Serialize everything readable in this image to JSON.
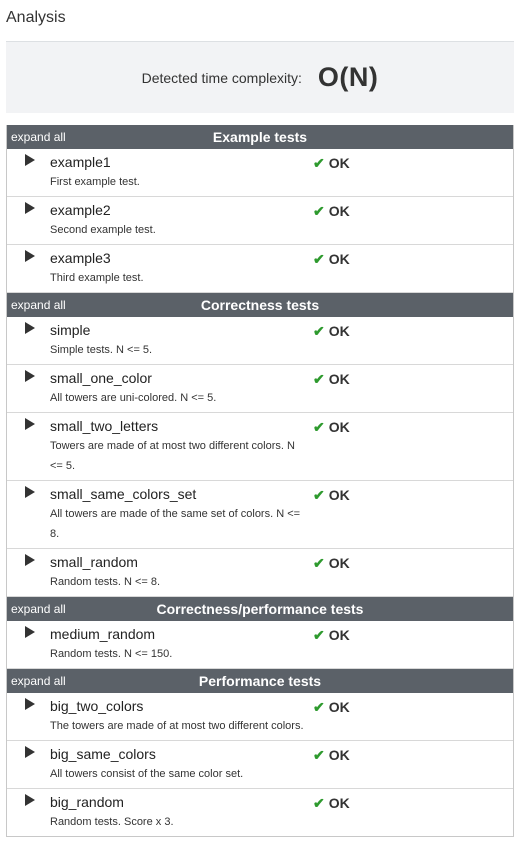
{
  "page": {
    "title": "Analysis"
  },
  "complexity": {
    "label": "Detected time complexity:",
    "value": "O(N)"
  },
  "expand_all_label": "expand all",
  "sections": [
    {
      "title": "Example tests",
      "tests": [
        {
          "name": "example1",
          "desc": "First example test.",
          "status": "OK"
        },
        {
          "name": "example2",
          "desc": "Second example test.",
          "status": "OK"
        },
        {
          "name": "example3",
          "desc": "Third example test.",
          "status": "OK"
        }
      ]
    },
    {
      "title": "Correctness tests",
      "tests": [
        {
          "name": "simple",
          "desc": "Simple tests. N <= 5.",
          "status": "OK"
        },
        {
          "name": "small_one_color",
          "desc": "All towers are uni-colored. N <= 5.",
          "status": "OK"
        },
        {
          "name": "small_two_letters",
          "desc": "Towers are made of at most two different colors. N <= 5.",
          "status": "OK"
        },
        {
          "name": "small_same_colors_set",
          "desc": "All towers are made of the same set of colors. N <= 8.",
          "status": "OK"
        },
        {
          "name": "small_random",
          "desc": "Random tests. N <= 8.",
          "status": "OK"
        }
      ]
    },
    {
      "title": "Correctness/performance tests",
      "tests": [
        {
          "name": "medium_random",
          "desc": "Random tests. N <= 150.",
          "status": "OK"
        }
      ]
    },
    {
      "title": "Performance tests",
      "tests": [
        {
          "name": "big_two_colors",
          "desc": "The towers are made of at most two different colors.",
          "status": "OK"
        },
        {
          "name": "big_same_colors",
          "desc": "All towers consist of the same color set.",
          "status": "OK"
        },
        {
          "name": "big_random",
          "desc": "Random tests. Score x 3.",
          "status": "OK"
        }
      ]
    }
  ],
  "colors": {
    "header_bg": "#5b6168",
    "ok_check": "#2e9a2e",
    "panel_bg": "#f2f3f5"
  },
  "icons": {
    "toggle": "triangle-right-icon",
    "check": "check-icon"
  }
}
